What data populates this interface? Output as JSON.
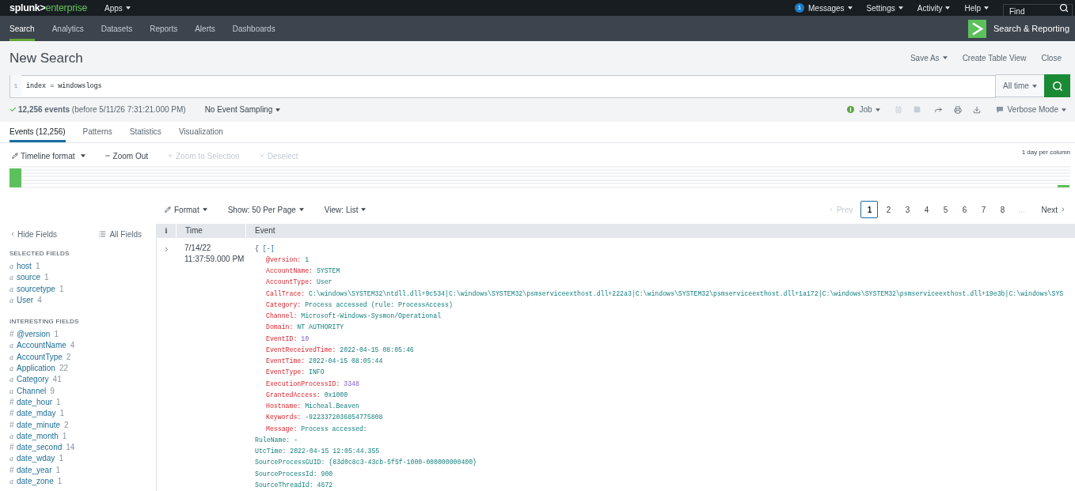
{
  "brand": {
    "name": "splunk>",
    "product": "enterprise"
  },
  "top_menu": {
    "apps": "Apps",
    "items": [
      {
        "label": "Messages",
        "badge": "1"
      },
      {
        "label": "Settings"
      },
      {
        "label": "Activity"
      },
      {
        "label": "Help"
      }
    ],
    "find": {
      "placeholder": "Find"
    }
  },
  "app_nav": {
    "tabs": [
      {
        "label": "Search",
        "selected": true
      },
      {
        "label": "Analytics",
        "selected": false
      },
      {
        "label": "Datasets",
        "selected": false
      },
      {
        "label": "Reports",
        "selected": false
      },
      {
        "label": "Alerts",
        "selected": false
      },
      {
        "label": "Dashboards",
        "selected": false
      }
    ],
    "app_title": "Search & Reporting"
  },
  "header": {
    "title": "New Search",
    "actions": [
      {
        "label": "Save As",
        "dropdown": true
      },
      {
        "label": "Create Table View",
        "dropdown": false
      },
      {
        "label": "Close",
        "dropdown": false
      }
    ]
  },
  "search_bar": {
    "line_number": "1",
    "query": "index = windowslogs",
    "time_range": "All time"
  },
  "job_bar": {
    "summary": "**12,256 events** (before 5/11/26 7:31:21.000 PM)",
    "sampling": "No Event Sampling",
    "job": "Job",
    "mode": "Verbose Mode"
  },
  "result_tabs": [
    {
      "label": "Events (12,256)",
      "selected": true
    },
    {
      "label": "Patterns",
      "selected": false
    },
    {
      "label": "Statistics",
      "selected": false
    },
    {
      "label": "Visualization",
      "selected": false
    }
  ],
  "timeline": {
    "actions": [
      {
        "kind": "format",
        "label": "Timeline format",
        "disabled": false
      },
      {
        "kind": "zoom_out",
        "label": "Zoom Out",
        "disabled": false
      },
      {
        "kind": "zoom_in",
        "label": "Zoom to Selection",
        "disabled": true
      },
      {
        "kind": "deselect",
        "label": "Deselect",
        "disabled": true
      }
    ],
    "scale": "1 day per column"
  },
  "results_toolbar": {
    "options": [
      {
        "kind": "format",
        "label": "Format"
      },
      {
        "kind": "menu",
        "label": "Show: 50 Per Page"
      },
      {
        "kind": "menu",
        "label": "View: List"
      }
    ],
    "prev": {
      "label": "Prev",
      "disabled": true
    },
    "pages": [
      {
        "label": "1",
        "selected": true
      },
      {
        "label": "2",
        "selected": false
      },
      {
        "label": "3",
        "selected": false
      },
      {
        "label": "4",
        "selected": false
      },
      {
        "label": "5",
        "selected": false
      },
      {
        "label": "6",
        "selected": false
      },
      {
        "label": "7",
        "selected": false
      },
      {
        "label": "8",
        "selected": false
      }
    ],
    "ellipsis": "...",
    "next": {
      "label": "Next",
      "disabled": false
    }
  },
  "sidebar": {
    "hide_fields": "Hide Fields",
    "all_fields": "All Fields",
    "groups": [
      {
        "title": "SELECTED FIELDS",
        "fields": [
          {
            "mark": "a",
            "kind": "string",
            "name": "host",
            "count": "1"
          },
          {
            "mark": "a",
            "kind": "string",
            "name": "source",
            "count": "1"
          },
          {
            "mark": "a",
            "kind": "string",
            "name": "sourcetype",
            "count": "1"
          },
          {
            "mark": "a",
            "kind": "string",
            "name": "User",
            "count": "4"
          }
        ]
      },
      {
        "title": "INTERESTING FIELDS",
        "fields": [
          {
            "mark": "#",
            "kind": "number",
            "name": "@version",
            "count": "1"
          },
          {
            "mark": "a",
            "kind": "string",
            "name": "AccountName",
            "count": "4"
          },
          {
            "mark": "a",
            "kind": "string",
            "name": "AccountType",
            "count": "2"
          },
          {
            "mark": "a",
            "kind": "string",
            "name": "Application",
            "count": "22"
          },
          {
            "mark": "a",
            "kind": "string",
            "name": "Category",
            "count": "41"
          },
          {
            "mark": "a",
            "kind": "string",
            "name": "Channel",
            "count": "9"
          },
          {
            "mark": "#",
            "kind": "number",
            "name": "date_hour",
            "count": "1"
          },
          {
            "mark": "#",
            "kind": "number",
            "name": "date_mday",
            "count": "1"
          },
          {
            "mark": "#",
            "kind": "number",
            "name": "date_minute",
            "count": "2"
          },
          {
            "mark": "a",
            "kind": "string",
            "name": "date_month",
            "count": "1"
          },
          {
            "mark": "#",
            "kind": "number",
            "name": "date_second",
            "count": "14"
          },
          {
            "mark": "a",
            "kind": "string",
            "name": "date_wday",
            "count": "1"
          },
          {
            "mark": "#",
            "kind": "number",
            "name": "date_year",
            "count": "1"
          },
          {
            "mark": "a",
            "kind": "string",
            "name": "date_zone",
            "count": "1"
          }
        ]
      }
    ]
  },
  "events_table": {
    "columns": [
      "i",
      "Time",
      "Event"
    ],
    "rows": [
      {
        "date": "7/14/22",
        "time": "11:37:59.000 PM",
        "event": {
          "open": "{",
          "toggle": "[-]",
          "fields": [
            {
              "key": "@version:",
              "value": "1",
              "kind": "string"
            },
            {
              "key": "AccountName:",
              "value": "SYSTEM",
              "kind": "string"
            },
            {
              "key": "AccountType:",
              "value": "User",
              "kind": "string"
            },
            {
              "key": "CallTrace:",
              "value": "C:\\windows\\SYSTEM32\\ntdll.dll+9c534|C:\\windows\\SYSTEM32\\psmserviceexthost.dll+222a3|C:\\windows\\SYSTEM32\\psmserviceexthost.dll+1a172|C:\\windows\\SYSTEM32\\psmserviceexthost.dll+19e3b|C:\\windows\\SYS",
              "kind": "string"
            },
            {
              "key": "Category:",
              "value": "Process accessed (rule: ProcessAccess)",
              "kind": "string"
            },
            {
              "key": "Channel:",
              "value": "Microsoft-Windows-Sysmon/Operational",
              "kind": "string"
            },
            {
              "key": "Domain:",
              "value": "NT AUTHORITY",
              "kind": "string"
            },
            {
              "key": "EventID:",
              "value": "10",
              "kind": "number"
            },
            {
              "key": "EventReceivedTime:",
              "value": "2022-04-15 08:05:46",
              "kind": "string"
            },
            {
              "key": "EventTime:",
              "value": "2022-04-15 08:05:44",
              "kind": "string"
            },
            {
              "key": "EventType:",
              "value": "INFO",
              "kind": "string"
            },
            {
              "key": "ExecutionProcessID:",
              "value": "3348",
              "kind": "number"
            },
            {
              "key": "GrantedAccess:",
              "value": "0x1000",
              "kind": "string"
            },
            {
              "key": "Hostname:",
              "value": "Micheal.Beaven",
              "kind": "string"
            },
            {
              "key": "Keywords:",
              "value": "-9223372036854775808",
              "kind": "string"
            },
            {
              "key": "Message:",
              "value": "Process accessed:",
              "kind": "string"
            }
          ],
          "continuation": [
            "RuleName: -",
            "UtcTime: 2022-04-15 12:05:44.355",
            "SourceProcessGUID: {83d0c8c3-43cb-5f5f-1000-000000000400}",
            "SourceProcessId: 900",
            "SourceThreadId: 4672"
          ]
        }
      }
    ]
  }
}
